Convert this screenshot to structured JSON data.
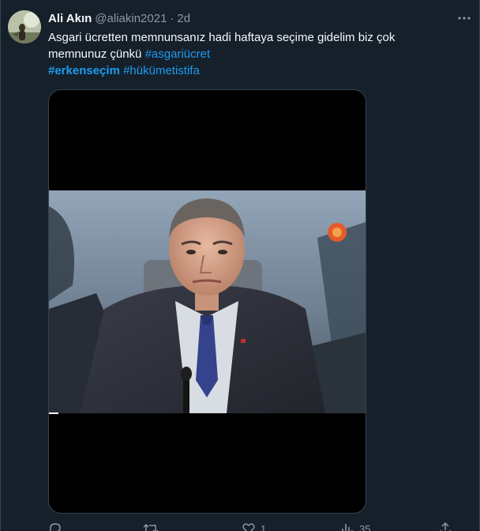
{
  "tweet": {
    "display_name": "Ali Akın",
    "handle": "@aliakin2021",
    "separator": "·",
    "time": "2d",
    "text_line1": "Asgari ücretten memnunsanız hadi haftaya seçime gidelim biz çok",
    "text_line2_plain": "memnunuz çünkü ",
    "hashtag_asgariucret": "#asgariücret",
    "hashtag_erkensecim": "#erkenseçim",
    "hashtag_hukumetistifa": "#hükümetistifa"
  },
  "media": {
    "type": "video"
  },
  "actions": {
    "reply_icon": "reply-icon",
    "retweet_icon": "retweet-icon",
    "like_icon": "heart-icon",
    "like_count": "1",
    "views_icon": "views-icon",
    "views_count": "35",
    "share_icon": "share-icon"
  },
  "colors": {
    "background": "#15202b",
    "text": "#f7f9f9",
    "muted": "#8b98a5",
    "accent": "#1d9bf0",
    "border": "#38444d"
  }
}
